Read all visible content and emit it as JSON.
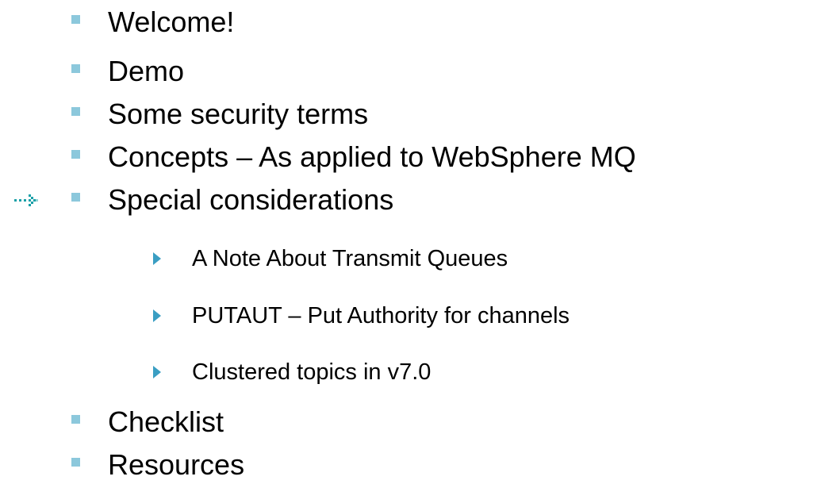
{
  "agenda": {
    "current_marker": {
      "icon": "arrow-pointer-icon",
      "color": "#1aa0a8"
    },
    "bullet_colors": {
      "level1": "#8cc8dc",
      "level2": "#3a9ec3"
    },
    "items": [
      {
        "label": "Welcome!"
      },
      {
        "label": "Demo"
      },
      {
        "label": "Some security terms"
      },
      {
        "label": "Concepts – As applied to WebSphere MQ"
      },
      {
        "label": "Special considerations",
        "sub_items": [
          {
            "label": "A Note About Transmit Queues"
          },
          {
            "label": "PUTAUT – Put Authority for channels"
          },
          {
            "label": "Clustered topics in v7.0"
          }
        ]
      },
      {
        "label": "Checklist"
      },
      {
        "label": "Resources"
      }
    ]
  }
}
